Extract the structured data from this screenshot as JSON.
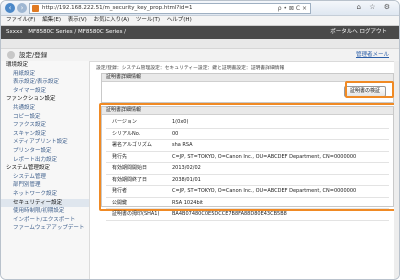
{
  "browser": {
    "back_icon": "back-arrow",
    "forward_icon": "forward-arrow",
    "url": "http://192.168.222.51/m_security_key_prop.html?id=1",
    "addr_tools": "ρ • ⊠ C ×",
    "right_tools": "⌂ ☆ ⚙"
  },
  "menubar": {
    "items": [
      "ファイル(F)",
      "編集(E)",
      "表示(V)",
      "お気に入り(A)",
      "ツール(T)",
      "ヘルプ(H)"
    ]
  },
  "header": {
    "logo": "Sxxxx",
    "device": "MF8580C Series / MF8580C Series /",
    "right": "ポータルへ  ログアウト"
  },
  "subbar": {
    "text": ""
  },
  "titlebar": {
    "title": "設定/登録",
    "right_link": "管理者メール"
  },
  "sidebar": {
    "sections": [
      {
        "label": "環境設定",
        "items": [
          "用紙設定",
          "表示設定/表示設定",
          "タイマー設定"
        ]
      },
      {
        "label": "ファンクション設定",
        "items": [
          "共通設定",
          "コピー設定",
          "ファクス設定",
          "スキャン設定",
          "メディアプリント設定",
          "プリンター設定",
          "レポート出力設定"
        ]
      },
      {
        "label": "システム管理設定",
        "items": [
          "システム管理",
          "部門別管理",
          "ネットワーク設定",
          "セキュリティー設定",
          "使用時制限/初期設定",
          "インポート/エクスポート",
          "ファームウェアアップデート"
        ]
      }
    ],
    "selected": "セキュリティー設定"
  },
  "main": {
    "breadcrumb": "設定/登録：システム管理設定：セキュリティー設定：鍵と証明書設定：証明書詳細情報",
    "top_box_header": "証明書詳細情報",
    "verify_button": "証明書の検証",
    "detail_box_header": "証明書詳細情報",
    "rows": [
      {
        "key": "バージョン",
        "value": "1(0x0)"
      },
      {
        "key": "シリアルNo.",
        "value": "00"
      },
      {
        "key": "署名アルゴリズム",
        "value": "sha RSA"
      },
      {
        "key": "発行先",
        "value": "C=JP, ST=TOKYO, O=Canon Inc., OU=ABCDEF Department, CN=0000000"
      },
      {
        "key": "有効期間開始日",
        "value": "2013/02/02"
      },
      {
        "key": "有効期間終了日",
        "value": "2038/01/01"
      },
      {
        "key": "発行者",
        "value": "C=JP, ST=TOKYO, O=Canon Inc., OU=ABCDEF Department, CN=0000000"
      },
      {
        "key": "公開鍵",
        "value": "RSA 1024bit"
      },
      {
        "key": "証明書の拇印(SHA1)",
        "value": "BA4B07480C0E5DCCE7B8FA88D80E43CB5B8"
      }
    ]
  },
  "colors": {
    "highlight": "#f08a24",
    "header": "#4a4a4a",
    "link": "#2b5ea8"
  }
}
